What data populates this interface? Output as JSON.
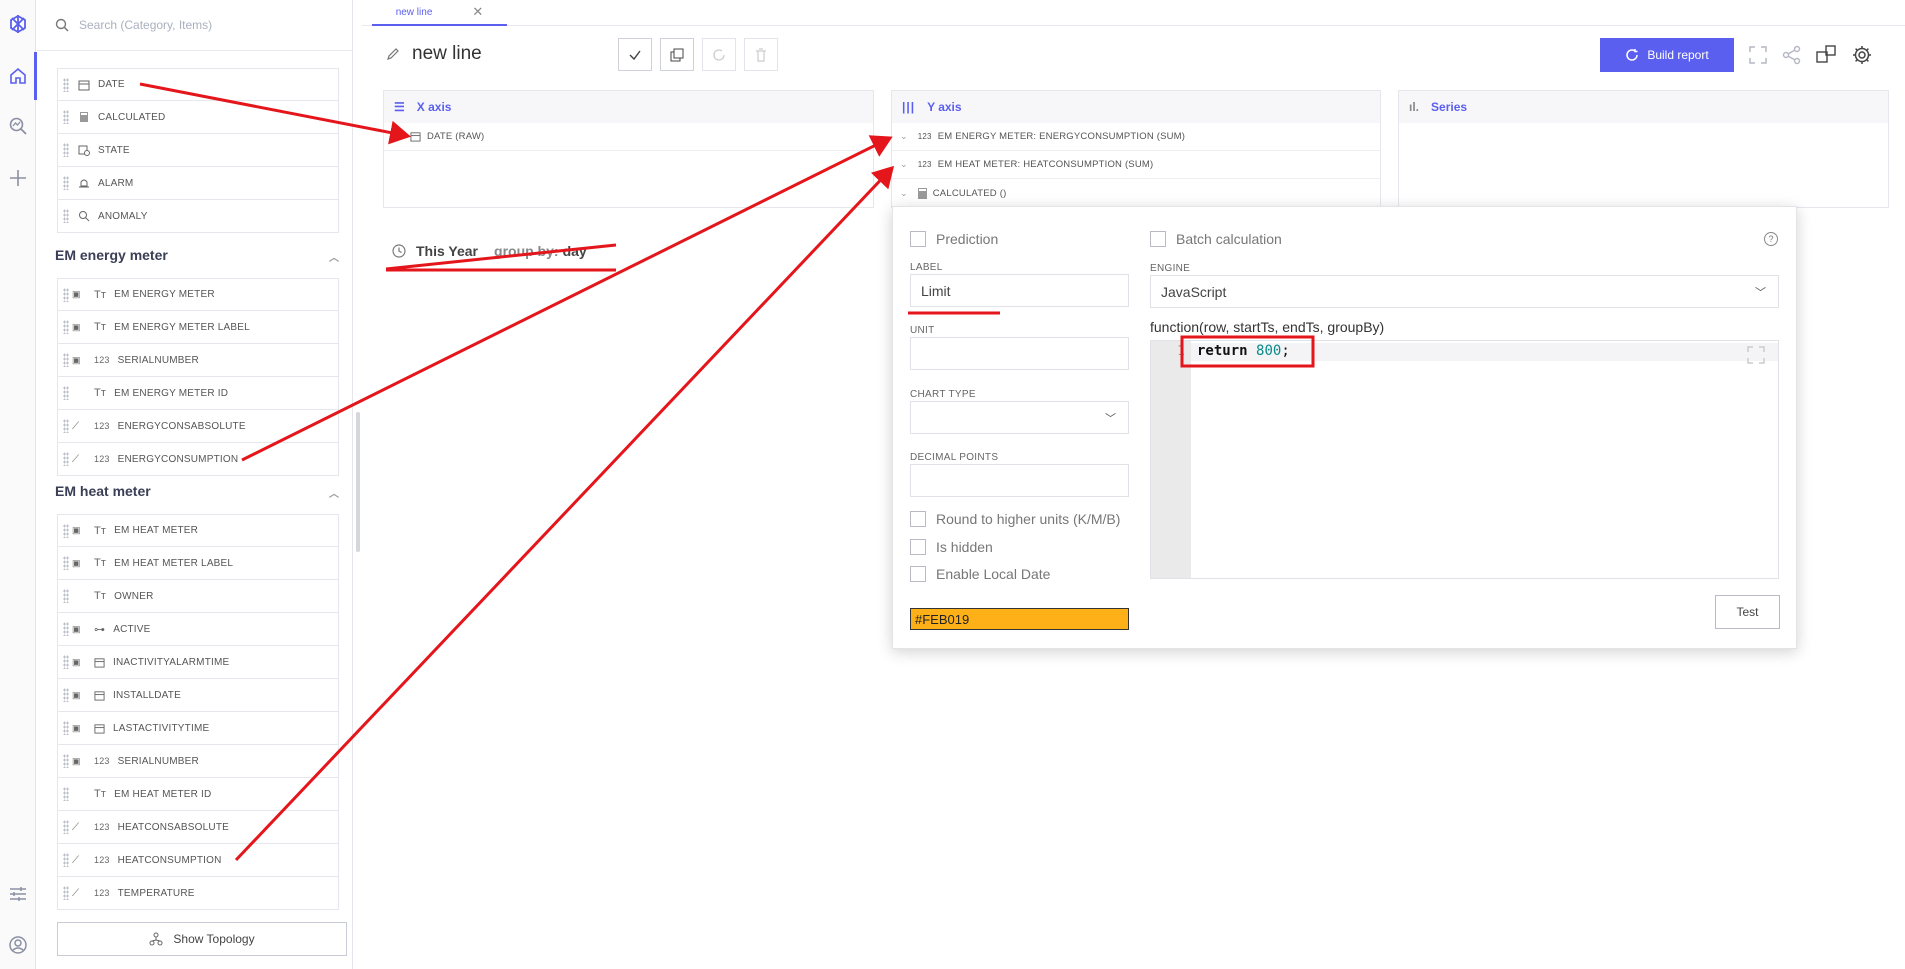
{
  "sidebar_search": {
    "placeholder": "Search (Category, Items)"
  },
  "base_items": [
    {
      "label": "DATE",
      "icon": "calendar-icon"
    },
    {
      "label": "CALCULATED",
      "icon": "calculator-icon"
    },
    {
      "label": "STATE",
      "icon": "state-icon"
    },
    {
      "label": "ALARM",
      "icon": "alarm-icon"
    },
    {
      "label": "ANOMALY",
      "icon": "anomaly-icon"
    }
  ],
  "energy_group": {
    "title": "EM energy meter",
    "items": [
      {
        "label": "EM ENERGY METER",
        "prefix": "Tт"
      },
      {
        "label": "EM ENERGY METER LABEL",
        "prefix": "Tт"
      },
      {
        "label": "SERIALNUMBER",
        "prefix": "123"
      },
      {
        "label": "EM ENERGY METER ID",
        "prefix": "Tт"
      },
      {
        "label": "ENERGYCONSABSOLUTE",
        "prefix": "123"
      },
      {
        "label": "ENERGYCONSUMPTION",
        "prefix": "123"
      }
    ]
  },
  "heat_group": {
    "title": "EM heat meter",
    "items": [
      {
        "label": "EM HEAT METER",
        "prefix": "Tт"
      },
      {
        "label": "EM HEAT METER LABEL",
        "prefix": "Tт"
      },
      {
        "label": "OWNER",
        "prefix": "Tт"
      },
      {
        "label": "ACTIVE",
        "prefix": "toggle"
      },
      {
        "label": "INACTIVITYALARMTIME",
        "prefix": "cal"
      },
      {
        "label": "INSTALLDATE",
        "prefix": "cal"
      },
      {
        "label": "LASTACTIVITYTIME",
        "prefix": "cal"
      },
      {
        "label": "SERIALNUMBER",
        "prefix": "123"
      },
      {
        "label": "EM HEAT METER ID",
        "prefix": "Tт"
      },
      {
        "label": "HEATCONSABSOLUTE",
        "prefix": "123"
      },
      {
        "label": "HEATCONSUMPTION",
        "prefix": "123"
      },
      {
        "label": "TEMPERATURE",
        "prefix": "123"
      }
    ]
  },
  "show_topology": "Show Topology",
  "tab": {
    "label": "new line"
  },
  "page_title": "new line",
  "build_report": "Build report",
  "zones": {
    "x_axis": {
      "title": "X axis",
      "rows": [
        "DATE (RAW)"
      ]
    },
    "y_axis": {
      "title": "Y axis",
      "rows": [
        "EM ENERGY METER: ENERGYCONSUMPTION (SUM)",
        "EM HEAT METER: HEATCONSUMPTION (SUM)",
        "CALCULATED ()"
      ]
    },
    "series": {
      "title": "Series"
    }
  },
  "period": {
    "range": "This Year",
    "group_label": "group by:",
    "group_value": "day"
  },
  "popup": {
    "prediction": "Prediction",
    "batch": "Batch calculation",
    "label_title": "LABEL",
    "label_value": "Limit",
    "unit_title": "UNIT",
    "chart_type_title": "CHART TYPE",
    "decimal_title": "DECIMAL POINTS",
    "round": "Round to higher units (K/M/B)",
    "hidden": "Is hidden",
    "local_date": "Enable Local Date",
    "engine_title": "ENGINE",
    "engine_value": "JavaScript",
    "function_sig": "function(row, startTs, endTs, groupBy)",
    "line_no": "1",
    "code_kw": "return",
    "code_num": "800",
    "code_end": ";",
    "color": "#FEB019",
    "test": "Test"
  },
  "colors": {
    "accent": "#5b5fef",
    "annotation": "#e5161b",
    "series_color": "#FEB019"
  }
}
